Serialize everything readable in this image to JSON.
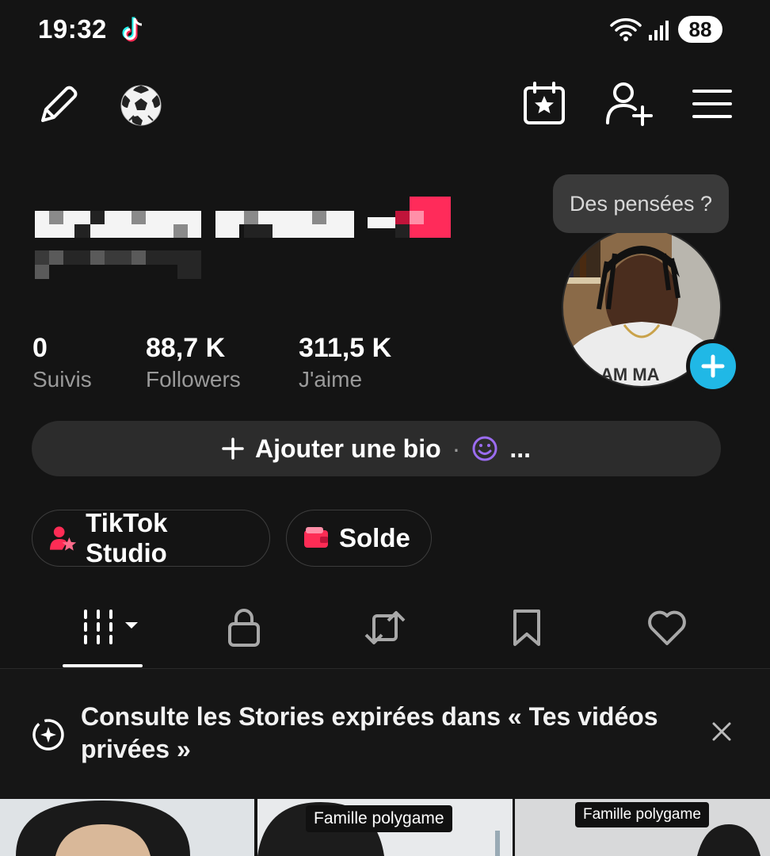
{
  "status_bar": {
    "time": "19:32",
    "battery": "88"
  },
  "profile": {
    "stats": [
      {
        "value": "0",
        "label": "Suivis"
      },
      {
        "value": "88,7 K",
        "label": "Followers"
      },
      {
        "value": "311,5 K",
        "label": "J'aime"
      }
    ],
    "tooltip": "Des pensées ?",
    "bio_button": {
      "label": "Ajouter une bio",
      "separator": "·",
      "ellipsis": "..."
    }
  },
  "shortcuts": [
    {
      "label": "TikTok Studio"
    },
    {
      "label": "Solde"
    }
  ],
  "banner": {
    "text": "Consulte les Stories expirées dans « Tes vidéos privées »"
  },
  "thumbnails": [
    {
      "tag": ""
    },
    {
      "tag": "Famille polygame"
    },
    {
      "tag": "Famille polygame"
    }
  ],
  "colors": {
    "background": "#141414",
    "accent_cyan": "#20b8e6",
    "accent_pink": "#fe2c55",
    "emoji_purple": "#9b6cf0"
  }
}
